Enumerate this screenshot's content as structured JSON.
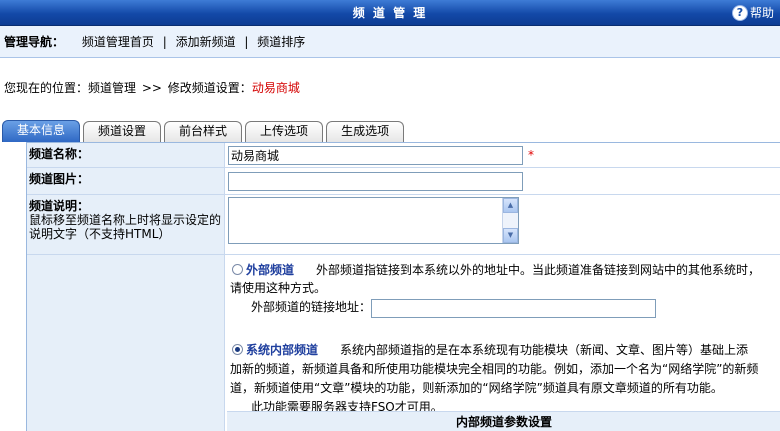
{
  "title_bar": {
    "title": "频 道 管 理",
    "help_label": "帮助",
    "help_icon": "question-circle-icon"
  },
  "nav": {
    "label": "管理导航：",
    "links": [
      "频道管理首页",
      "添加新频道",
      "频道排序"
    ],
    "separator": "|"
  },
  "location": {
    "prefix": "您现在的位置：",
    "crumb1": "频道管理",
    "arrow": ">>",
    "crumb2": "修改频道设置：",
    "current": "动易商城"
  },
  "tabs": [
    "基本信息",
    "频道设置",
    "前台样式",
    "上传选项",
    "生成选项"
  ],
  "active_tab": 0,
  "form": {
    "channel_name": {
      "label": "频道名称：",
      "value": "动易商城",
      "required_mark": "*"
    },
    "channel_image": {
      "label": "频道图片：",
      "value": ""
    },
    "channel_desc": {
      "label": "频道说明：",
      "hint1": "鼠标移至频道名称上时将显示设定的",
      "hint2": "说明文字（不支持HTML）",
      "value": ""
    },
    "external": {
      "title": "外部频道",
      "desc1": "外部频道指链接到本系统以外的地址中。当此频道准备链接到网站中的其他系统时，",
      "desc2": "请使用这种方式。",
      "link_label": "外部频道的链接地址：",
      "link_value": "",
      "checked": false
    },
    "internal": {
      "title": "系统内部频道",
      "desc1": "系统内部频道指的是在本系统现有功能模块（新闻、文章、图片等）基础上添",
      "desc2": "加新的频道，新频道具备和所使用功能模块完全相同的功能。例如，添加一个名为“网络学院”的新频",
      "desc3": "道，新频道使用“文章”模块的功能，则新添加的“网络学院”频道具有原文章频道的所有功能。",
      "note": "此功能需要服务器支持FSO才可用。",
      "checked": true
    },
    "internal_params_header": "内部频道参数设置"
  }
}
